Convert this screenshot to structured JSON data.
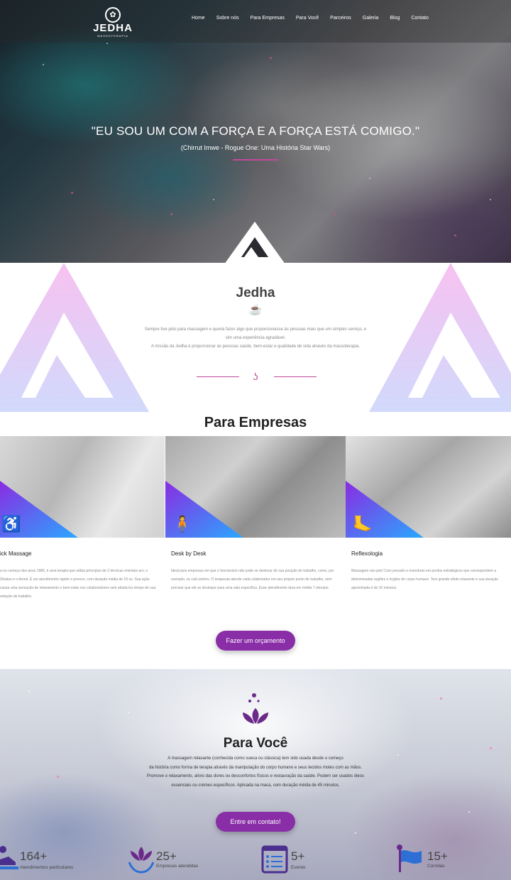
{
  "header": {
    "logo_text": "JEDHA",
    "logo_sub": "MASSOTERAPIA",
    "nav": [
      "Home",
      "Sobre nós",
      "Para Empresas",
      "Para Você",
      "Parceiros",
      "Galeria",
      "Blog",
      "Contato"
    ]
  },
  "hero": {
    "quote": "\"EU SOU UM COM A FORÇA E A FORÇA ESTÁ COMIGO.\"",
    "cite": "(Chirrut Imwe - Rogue One: Uma História Star Wars)"
  },
  "about": {
    "title": "Jedha",
    "paragraph_1": "Sempre tive jeito para massagem e queria fazer algo que proporcionasse às pessoas mais que um simples serviço, e",
    "paragraph_2": "sim uma experiência agradável.",
    "paragraph_3": "A missão da Jedha é proporcionar às pessoas saúde, bem-estar e qualidade de vida através da massoterapia."
  },
  "empresas": {
    "title": "Para Empresas",
    "services": [
      {
        "title": "ick Massage",
        "text": "a no começo dos anos 1980, é uma terapia que utiliza princípios de 2 técnicas orientais aro, o Shiatsu e o Anmá. É um atendimento rápido e preciso, com duração média de 15 os. Sua ação causa uma sensação de relaxamento e bem-estar nos colaboradores sem afastá-los tempo de sua estação de trabalho."
      },
      {
        "title": "Desk by Desk",
        "text": "Ideal para empresas em que o funcionário não pode se deslocar de sua posição de trabalho, como, por exemplo, os call centers. O terapeuta atende cada colaborador em seu próprio posto de trabalho, sem precisar que ele se desloque para uma sala específica. Esse atendimento dura em média 7 minutos."
      },
      {
        "title": "Reflexologia",
        "text": "Massagem nos pés! Com pressão e manobras em pontos estratégicos que correspondem a determinadas regiões e órgãos do corpo humano. Tem grande efeito relaxante e sua duração aproximada é de 10 minutos."
      }
    ],
    "button": "Fazer um orçamento"
  },
  "voce": {
    "title": "Para Você",
    "text_1": "A massagem relaxante (conhecida como sueca ou clássica) tem sido usada desde o começo",
    "text_2": "da história como forma de terapia através da manipulação do corpo humano e seus tecidos moles com as mãos.",
    "text_3": "Promove o relaxamento, alívio das dores ou desconfortos físicos e restauração da saúde. Podem ser usados óleos",
    "text_4": "essenciais ou cremes específicos. Aplicada na maca, com duração média de 45 minutos.",
    "button": "Entre em contato!"
  },
  "stats": [
    {
      "number": "164+",
      "label": "Atendimentos particulares",
      "icon": "massage-icon"
    },
    {
      "number": "25+",
      "label": "Empresas atendidas",
      "icon": "lotus-hands-icon"
    },
    {
      "number": "5+",
      "label": "Evento",
      "icon": "calendar-list-icon"
    },
    {
      "number": "15+",
      "label": "Corridas",
      "icon": "flag-icon"
    }
  ],
  "colors": {
    "accent": "#8a2ea8",
    "pink_line": "#c04a9a",
    "deco_gradient_top": "#f6b6ee",
    "deco_gradient_bottom": "#c9d3fb"
  }
}
